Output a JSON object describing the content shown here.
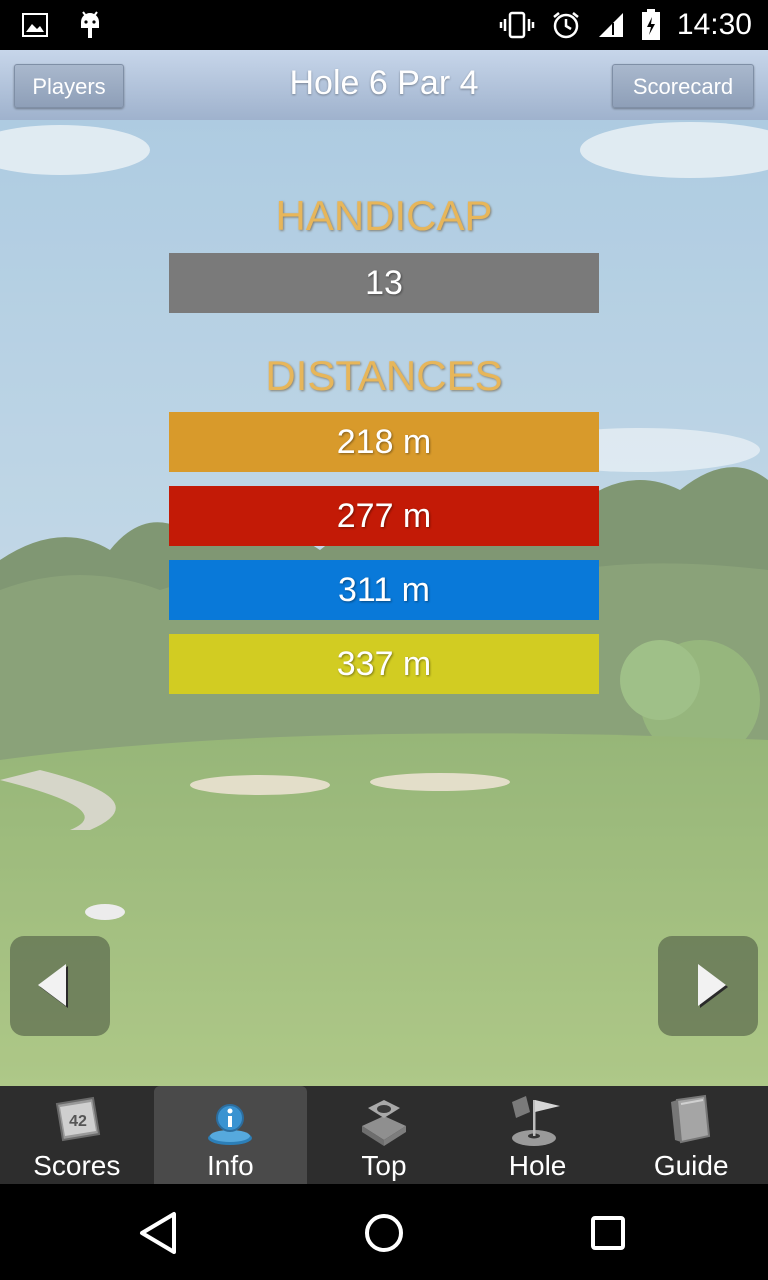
{
  "status_bar": {
    "time": "14:30",
    "left_icons": [
      "image-icon",
      "android-icon"
    ],
    "right_icons": [
      "vibrate-icon",
      "alarm-icon",
      "signal-icon",
      "battery-icon"
    ]
  },
  "title_bar": {
    "players_label": "Players",
    "title": "Hole 6 Par 4",
    "scorecard_label": "Scorecard"
  },
  "handicap": {
    "heading": "HANDICAP",
    "value": "13"
  },
  "distances": {
    "heading": "DISTANCES",
    "items": [
      {
        "value": "218 m",
        "color": "#d89a2b"
      },
      {
        "value": "277 m",
        "color": "#c31a06"
      },
      {
        "value": "311 m",
        "color": "#0979d9"
      },
      {
        "value": "337 m",
        "color": "#d2cc22"
      }
    ]
  },
  "tabs": [
    {
      "label": "Scores",
      "icon": "scores-icon",
      "active": false
    },
    {
      "label": "Info",
      "icon": "info-icon",
      "active": true
    },
    {
      "label": "Top",
      "icon": "top-icon",
      "active": false
    },
    {
      "label": "Hole",
      "icon": "hole-flag-icon",
      "active": false
    },
    {
      "label": "Guide",
      "icon": "guide-book-icon",
      "active": false
    }
  ],
  "scores_icon_number": "42",
  "colors": {
    "heading": "#e7b65a",
    "handicap_bar": "#7a7a7a",
    "tabbar": "#2d2d2d"
  }
}
